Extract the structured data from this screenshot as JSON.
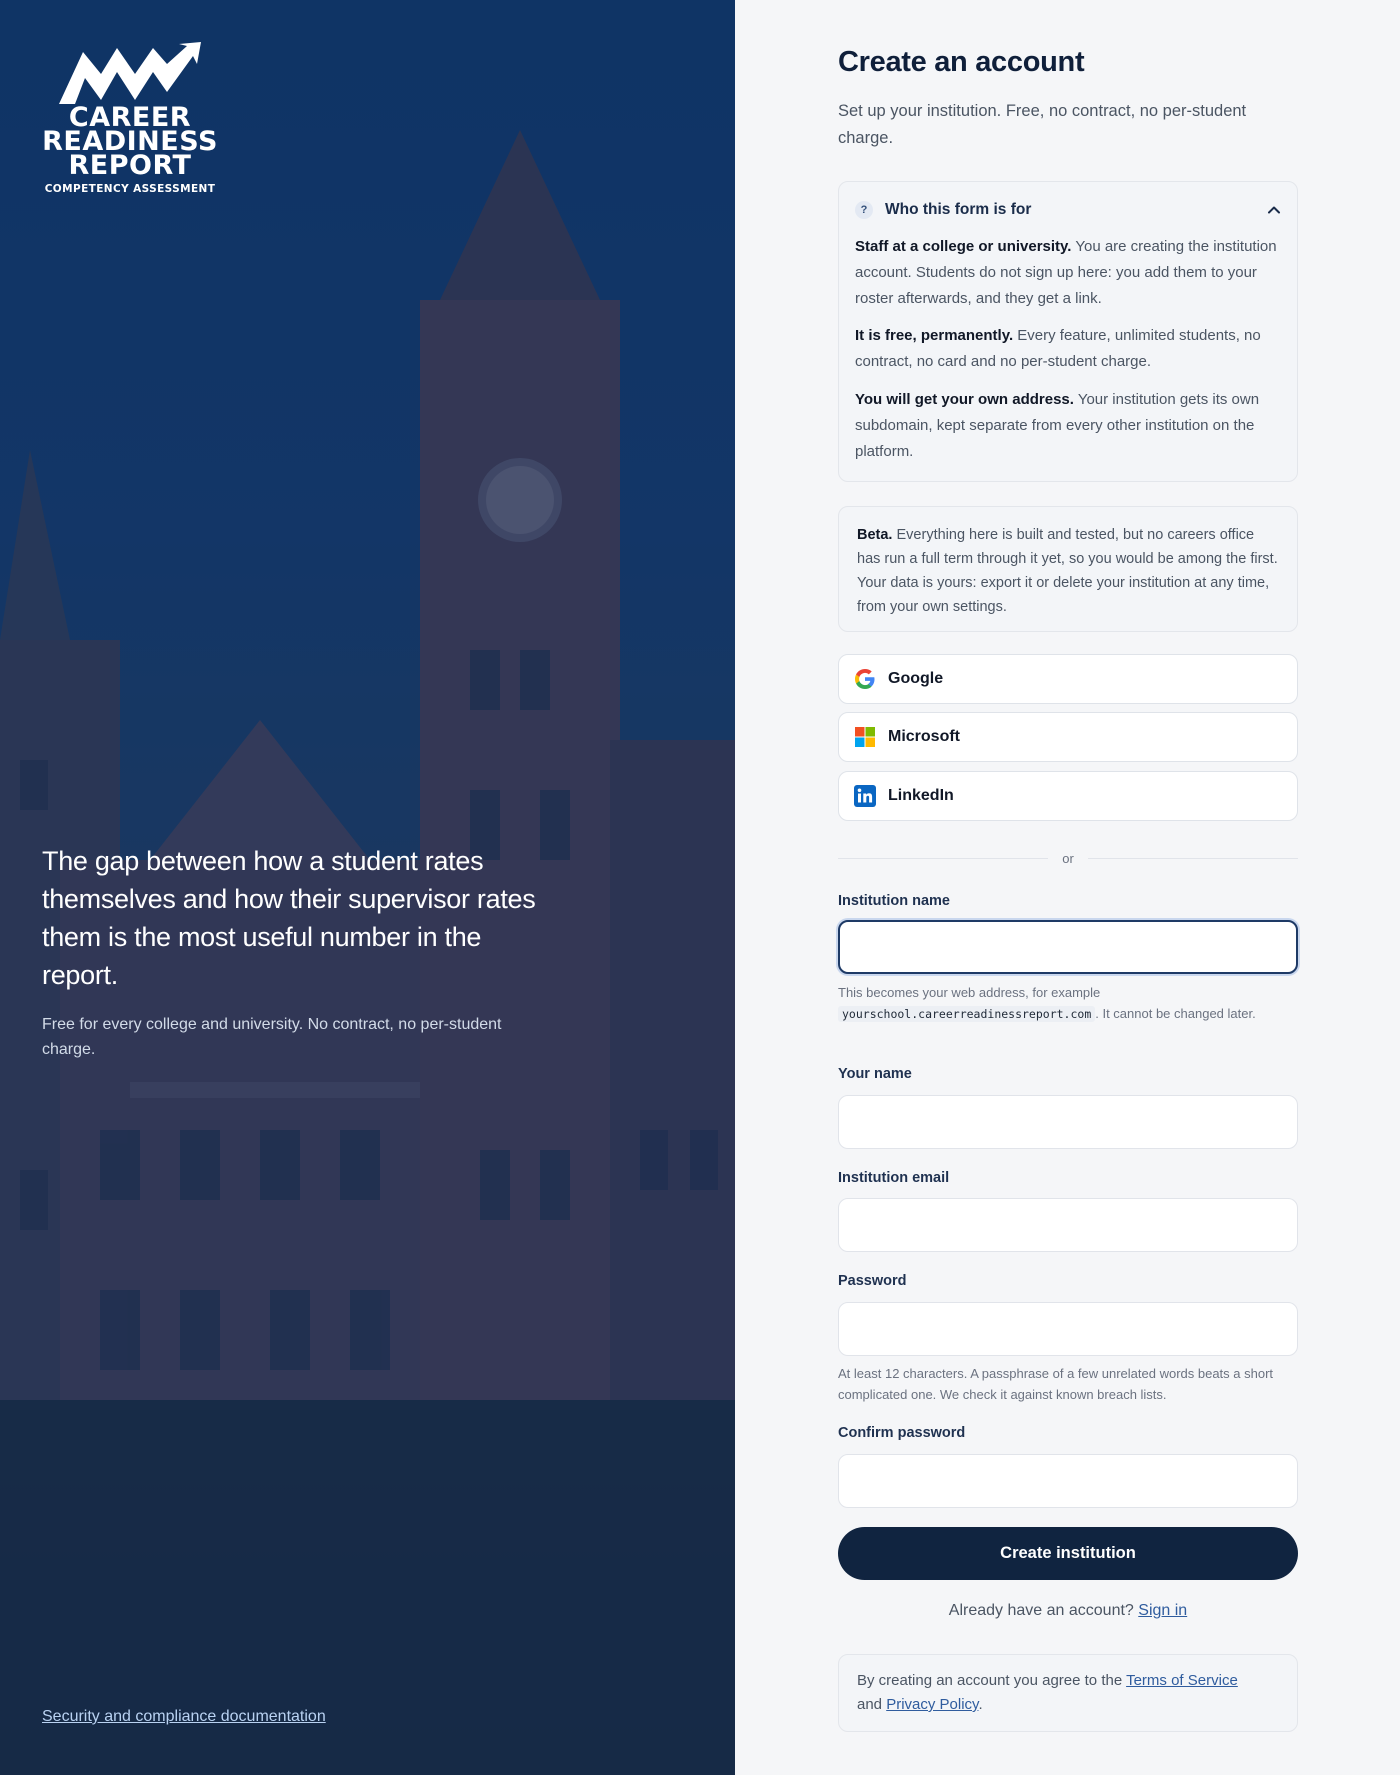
{
  "brand": {
    "logo_line1": "CAREER",
    "logo_line2": "READINESS",
    "logo_line3": "REPORT",
    "logo_sub": "COMPETENCY ASSESSMENT"
  },
  "left": {
    "quote": "The gap between how a student rates themselves and how their supervisor rates them is the most useful number in the report.",
    "subtext": "Free for every college and university. No contract, no per-student charge.",
    "security_link": "Security and compliance documentation"
  },
  "form": {
    "title": "Create an account",
    "subtitle": "Set up your institution. Free, no contract, no per-student charge.",
    "faq": {
      "badge": "?",
      "title": "Who this form is for",
      "items": [
        {
          "bold": "Staff at a college or university.",
          "text": "You are creating the institution account. Students do not sign up here: you add them to your roster afterwards, and they get a link."
        },
        {
          "bold": "It is free, permanently.",
          "text": "Every feature, unlimited students, no contract, no card and no per-student charge."
        },
        {
          "bold": "You will get your own address.",
          "text": "Your institution gets its own subdomain, kept separate from every other institution on the platform."
        }
      ]
    },
    "beta": {
      "bold": "Beta.",
      "text": "Everything here is built and tested, but no careers office has run a full term through it yet, so you would be among the first. Your data is yours: export it or delete your institution at any time, from your own settings."
    },
    "sso": {
      "google": "Google",
      "microsoft": "Microsoft",
      "linkedin": "LinkedIn"
    },
    "divider": "or",
    "fields": {
      "institution_name": {
        "label": "Institution name",
        "value": ""
      },
      "institution_help_before": "This becomes your web address, for example",
      "institution_help_code": "yourschool.careerreadinessreport.com",
      "institution_help_after": ". It cannot be changed later.",
      "your_name": {
        "label": "Your name",
        "value": ""
      },
      "institution_email": {
        "label": "Institution email",
        "value": ""
      },
      "password": {
        "label": "Password",
        "value": ""
      },
      "password_help": "At least 12 characters. A passphrase of a few unrelated words beats a short complicated one. We check it against known breach lists.",
      "confirm_password": {
        "label": "Confirm password",
        "value": ""
      }
    },
    "submit": "Create institution",
    "signin_prompt": "Already have an account?",
    "signin_link": "Sign in",
    "terms_before": "By creating an account you agree to the",
    "terms_link": "Terms of Service",
    "terms_and": "and",
    "privacy_link": "Privacy Policy",
    "terms_end": "."
  },
  "colors": {
    "primary": "#102440",
    "accent": "#1e3a66",
    "link": "#2f5c9e",
    "panel_blue": "#153e74"
  }
}
